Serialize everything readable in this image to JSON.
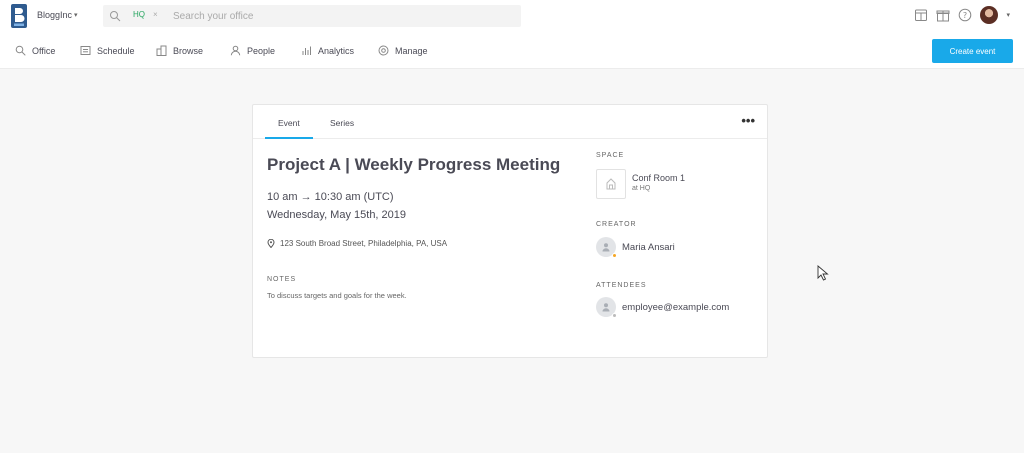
{
  "app": {
    "org_name": "BloggInc",
    "search": {
      "chip_label": "HQ",
      "chip_remove": "×",
      "placeholder": "Search your office"
    }
  },
  "nav": {
    "items": [
      {
        "label": "Office",
        "icon": "search-icon"
      },
      {
        "label": "Schedule",
        "icon": "schedule-icon"
      },
      {
        "label": "Browse",
        "icon": "browse-icon"
      },
      {
        "label": "People",
        "icon": "people-icon"
      },
      {
        "label": "Analytics",
        "icon": "analytics-icon"
      },
      {
        "label": "Manage",
        "icon": "manage-icon"
      }
    ],
    "create_event_label": "Create event"
  },
  "event": {
    "tabs": [
      {
        "label": "Event",
        "active": true
      },
      {
        "label": "Series",
        "active": false
      }
    ],
    "more_label": "•••",
    "title": "Project A | Weekly Progress Meeting",
    "time": "10 am → 10:30 am (UTC)",
    "date": "Wednesday, May 15th, 2019",
    "address": "123 South Broad Street, Philadelphia, PA, USA",
    "notes_heading": "NOTES",
    "notes_text": "To discuss targets and goals for the week."
  },
  "sidebar": {
    "space_heading": "SPACE",
    "space_name": "Conf Room 1",
    "space_location": "at HQ",
    "creator_heading": "CREATOR",
    "creator_name": "Maria Ansari",
    "creator_status_color": "#f5a623",
    "attendees_heading": "ATTENDEES",
    "attendee_email": "employee@example.com",
    "attendee_status_color": "#bbbbbb"
  },
  "colors": {
    "accent": "#19a9e9",
    "chip_green": "#27a560"
  }
}
